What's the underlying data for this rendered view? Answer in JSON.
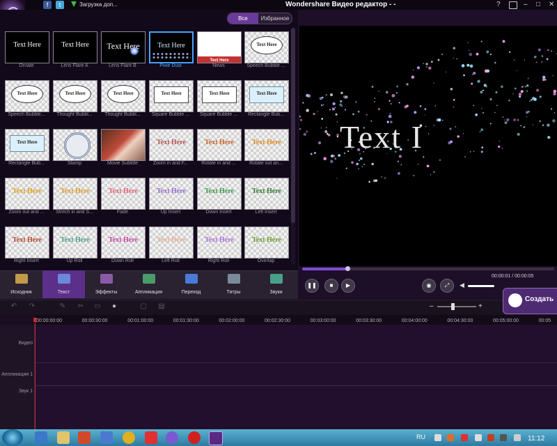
{
  "titlebar": {
    "title": "Wondershare Видео редактор - -",
    "download_label": "Загрузка доп...",
    "fb_glyph": "f",
    "tw_glyph": "t",
    "help_glyph": "?",
    "minimize_glyph": "–",
    "maximize_glyph": "□",
    "close_glyph": "✕"
  },
  "filter": {
    "all": "Все",
    "favorites": "Избранное"
  },
  "templates": [
    {
      "label": "Ornate",
      "preview": "Text Here",
      "style": "ornate"
    },
    {
      "label": "Lens Flare A",
      "preview": "Text Here",
      "style": "flareA"
    },
    {
      "label": "Lens Flare B",
      "preview": "Text Here",
      "style": "flareB"
    },
    {
      "label": "Pixie Dust",
      "preview": "Text Here",
      "style": "pixie",
      "selected": true
    },
    {
      "label": "News",
      "preview": "Text Here",
      "style": "news"
    },
    {
      "label": "Speech Bubble ...",
      "preview": "Text Here",
      "style": "bubble"
    },
    {
      "label": "Speech Bubble...",
      "preview": "Text Here",
      "style": "bubble"
    },
    {
      "label": "Thought Bubbl...",
      "preview": "Text Here",
      "style": "bubble"
    },
    {
      "label": "Thought Bubbl...",
      "preview": "Text Here",
      "style": "bubble"
    },
    {
      "label": "Square Bubble ...",
      "preview": "Text Here",
      "style": "square"
    },
    {
      "label": "Square Bubble ...",
      "preview": "Text Here",
      "style": "square"
    },
    {
      "label": "Rectangle Bub...",
      "preview": "Text Here",
      "style": "squareblue"
    },
    {
      "label": "Rectangle Bub...",
      "preview": "Text Here",
      "style": "squareblue"
    },
    {
      "label": "Stamp",
      "preview": "",
      "style": "stamp"
    },
    {
      "label": "Movie Subtitle",
      "preview": "",
      "style": "photo"
    },
    {
      "label": "Zoom in and F...",
      "preview": "Text Here",
      "style": "plain",
      "color": "#b85454"
    },
    {
      "label": "Rotate in and ...",
      "preview": "Text Here",
      "style": "plain",
      "color": "#c8652a"
    },
    {
      "label": "Rotate out an...",
      "preview": "Text Here",
      "style": "plain",
      "color": "#e08a1a"
    },
    {
      "label": "Zoom out and ...",
      "preview": "Text Here",
      "style": "plain",
      "color": "#e0a21a"
    },
    {
      "label": "Strech in and S...",
      "preview": "Text Here",
      "style": "plain",
      "color": "#e09a2a"
    },
    {
      "label": "Fade",
      "preview": "Text Here",
      "style": "plain",
      "color": "#e8607a"
    },
    {
      "label": "Up Insert",
      "preview": "Text Here",
      "style": "plain",
      "color": "#9a6ad0"
    },
    {
      "label": "Down Insert",
      "preview": "Text Here",
      "style": "plain",
      "color": "#3a9a4a"
    },
    {
      "label": "Left Insert",
      "preview": "Text Here",
      "style": "plain",
      "color": "#2e7a2e"
    },
    {
      "label": "Right Insert",
      "preview": "Text Here",
      "style": "plain",
      "color": "#c0402a"
    },
    {
      "label": "Up Roll",
      "preview": "Text Here",
      "style": "plain",
      "color": "#4aa08a"
    },
    {
      "label": "Down Roll",
      "preview": "Text Here",
      "style": "plain",
      "color": "#d040a8"
    },
    {
      "label": "Left Roll",
      "preview": "Text Here",
      "style": "plain",
      "color": "#e8b090"
    },
    {
      "label": "Right Roll",
      "preview": "Text Here",
      "style": "plain",
      "color": "#b070e0"
    },
    {
      "label": "Overlap",
      "preview": "Text Here",
      "style": "overlap",
      "color": "#6aa02a"
    }
  ],
  "tabs": [
    {
      "label": "Исходник",
      "icon": "film-folder-icon",
      "active": false
    },
    {
      "label": "Текст",
      "icon": "text-icon",
      "active": true
    },
    {
      "label": "Эффекты",
      "icon": "effects-icon",
      "active": false
    },
    {
      "label": "Аппликация",
      "icon": "sticker-icon",
      "active": false
    },
    {
      "label": "Переход",
      "icon": "transition-icon",
      "active": false
    },
    {
      "label": "Титры",
      "icon": "credits-icon",
      "active": false
    },
    {
      "label": "Звуки",
      "icon": "music-icon",
      "active": false
    }
  ],
  "preview": {
    "text": "Text I",
    "time": "00:00:01 / 00:00:05",
    "progress": 0.18,
    "volume": 1.0
  },
  "controls": {
    "pause_glyph": "❚❚",
    "stop_glyph": "■",
    "next_glyph": "▶",
    "snapshot_glyph": "◉",
    "fullscreen_glyph": "⤢",
    "volume_glyph": "◀"
  },
  "create": {
    "label": "Создать"
  },
  "timeline": {
    "zoom_minus": "–",
    "zoom_plus": "+",
    "ticks": [
      "00:00:00:00",
      "00:00:30:00",
      "00:01:00:00",
      "00:01:30:00",
      "00:02:00:00",
      "00:02:30:00",
      "00:03:00:00",
      "00:03:30:00",
      "00:04:00:00",
      "00:04:30:00",
      "00:05:00:00",
      "00:05"
    ],
    "tracks": [
      "Видео",
      "Аппликация 1",
      "Звук 1"
    ]
  },
  "taskbar": {
    "lang": "RU",
    "clock": "11:12"
  },
  "colors": {
    "accent": "#6a3a9a",
    "selection": "#46a3ff",
    "playhead": "#c62d2d"
  }
}
